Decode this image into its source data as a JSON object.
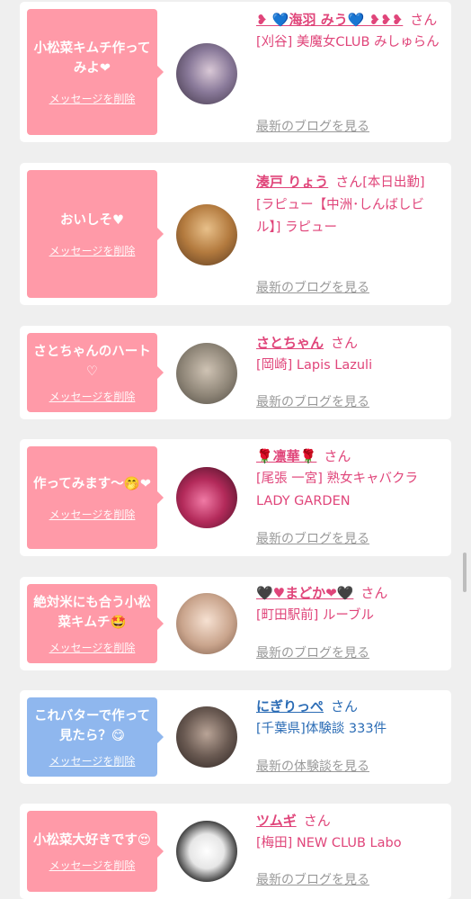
{
  "cards": [
    {
      "message": "小松菜キムチ作ってみよ❤",
      "delete_label": "メッセージを削除",
      "name": "❥ 💙海羽 みう💙 ❥❥❥",
      "honorific": "さん",
      "shop": "[刈谷] 美魔女CLUB みしゅらん",
      "link": "最新のブログを見る",
      "theme": "pink"
    },
    {
      "message": "おいしそ♥",
      "delete_label": "メッセージを削除",
      "name": "湊戸 りょう",
      "honorific": "さん",
      "status": "[本日出勤]",
      "shop": "[ラピュー【中洲･しんばしビル】] ラピュー",
      "link": "最新のブログを見る",
      "theme": "pink"
    },
    {
      "message": "さとちゃんのハート♡",
      "delete_label": "メッセージを削除",
      "name": "さとちゃん",
      "honorific": "さん",
      "shop": "[岡崎] Lapis Lazuli",
      "link": "最新のブログを見る",
      "theme": "pink"
    },
    {
      "message": "作ってみます〜🤭❤",
      "delete_label": "メッセージを削除",
      "name": "🌹凛華🌹",
      "honorific": "さん",
      "shop": "[尾張 一宮] 熟女キャバクラ LADY GARDEN",
      "link": "最新のブログを見る",
      "theme": "pink"
    },
    {
      "message": "絶対米にも合う小松菜キムチ🤩",
      "delete_label": "メッセージを削除",
      "name": "🖤♥まどか❤🖤",
      "honorific": "さん",
      "shop": "[町田駅前] ルーブル",
      "link": "最新のブログを見る",
      "theme": "pink"
    },
    {
      "message": "これバターで作って見たら？😋",
      "delete_label": "メッセージを削除",
      "name": "にぎりっぺ",
      "honorific": "さん",
      "shop": "[千葉県]体験談 333件",
      "link": "最新の体験談を見る",
      "theme": "blue"
    },
    {
      "message": "小松菜大好きです😍",
      "delete_label": "メッセージを削除",
      "name": "ツムギ",
      "honorific": "さん",
      "shop": "[梅田] NEW CLUB Labo",
      "link": "最新のブログを見る",
      "theme": "pink"
    }
  ]
}
